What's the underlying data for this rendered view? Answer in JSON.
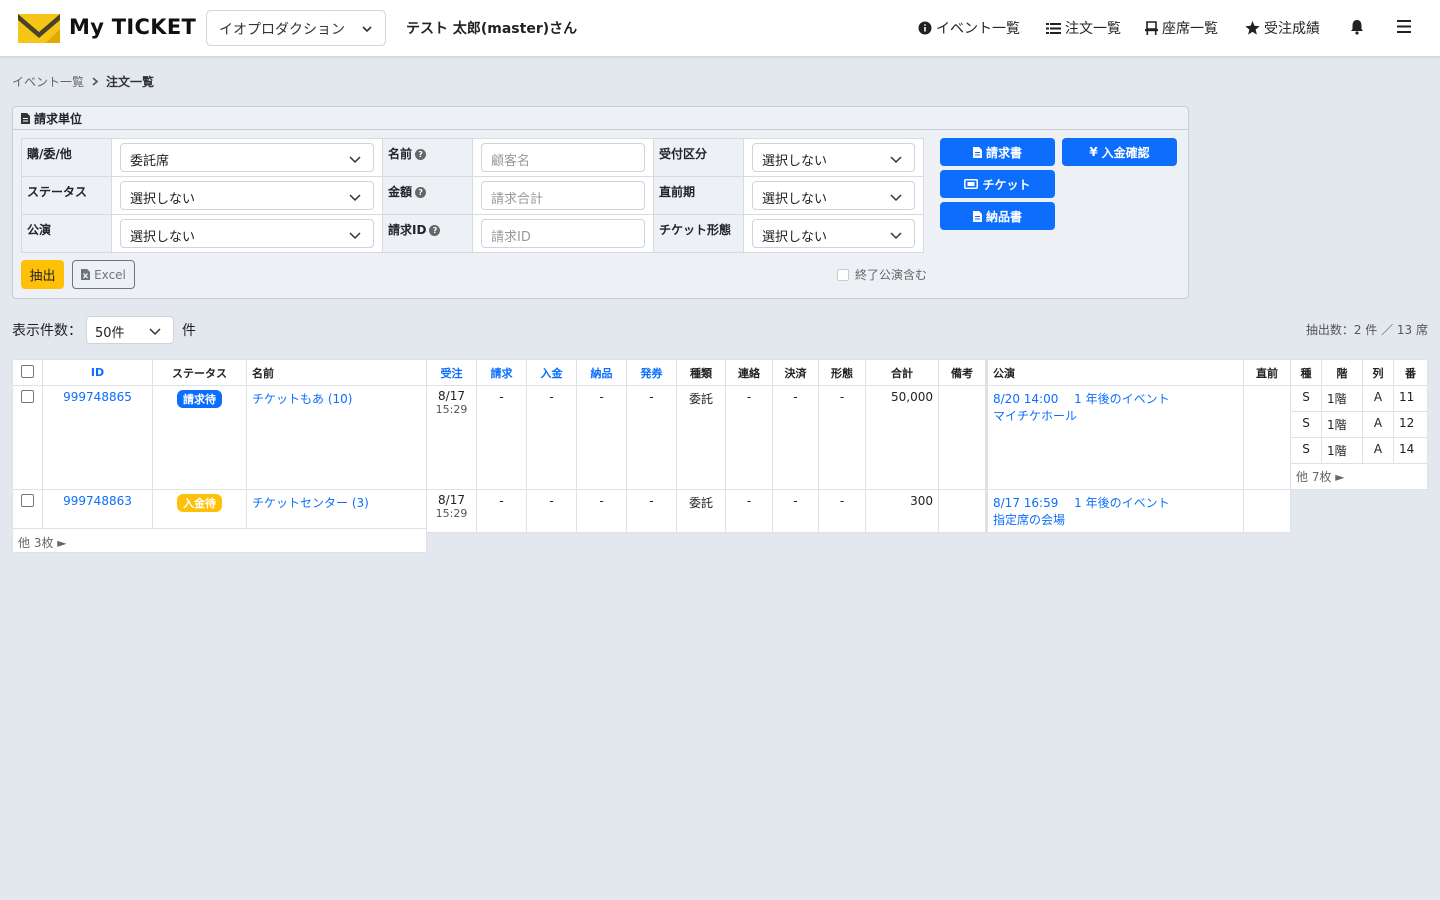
{
  "header": {
    "brand": "My TICKET",
    "org": "イオプロダクション",
    "user": "テスト 太郎(master)さん",
    "nav": [
      {
        "label": "イベント一覧",
        "icon": "info-circle-icon"
      },
      {
        "label": "注文一覧",
        "icon": "list-icon"
      },
      {
        "label": "座席一覧",
        "icon": "seat-icon"
      },
      {
        "label": "受注成績",
        "icon": "star-icon"
      }
    ]
  },
  "breadcrumb": {
    "parent": "イベント一覧",
    "current": "注文一覧"
  },
  "filter": {
    "title": "請求単位",
    "labels": {
      "type": "購/委/他",
      "status": "ステータス",
      "performance": "公演",
      "name": "名前",
      "amount": "金額",
      "invoice_id": "請求ID",
      "reception": "受付区分",
      "last_minute": "直前期",
      "ticket_form": "チケット形態"
    },
    "values": {
      "type": "委託席",
      "status": "選択しない",
      "performance": "選択しない",
      "reception": "選択しない",
      "last_minute": "選択しない",
      "ticket_form": "選択しない"
    },
    "placeholders": {
      "name": "顧客名",
      "amount": "請求合計",
      "invoice_id": "請求ID"
    },
    "buttons": {
      "invoice": "請求書",
      "payment": "入金確認",
      "ticket": "チケット",
      "delivery": "納品書",
      "extract": "抽出",
      "excel": "Excel"
    },
    "include_ended": "終了公演含む"
  },
  "display": {
    "label": "表示件数：",
    "value": "50件",
    "unit": "件"
  },
  "result_count": "抽出数：2 件 ／ 13 席",
  "table": {
    "headers": [
      "ID",
      "ステータス",
      "名前",
      "受注",
      "請求",
      "入金",
      "納品",
      "発券",
      "種類",
      "連絡",
      "決済",
      "形態",
      "合計",
      "備考",
      "公演",
      "直前",
      "種",
      "階",
      "列",
      "番"
    ],
    "rows": [
      {
        "id": "999748865",
        "status": "請求待",
        "name": "チケットもあ (10)",
        "order_date": "8/17",
        "order_time": "15:29",
        "invoice": "-",
        "payment": "-",
        "delivery": "-",
        "issue": "-",
        "kind": "委託",
        "contact": "-",
        "settle": "-",
        "form": "-",
        "total": "50,000",
        "note": "",
        "perf_datetime": "8/20 14:00",
        "perf_title": "1 年後のイベント",
        "venue": "マイチケホール",
        "seats": [
          {
            "type": "S",
            "floor": "1階",
            "row": "A",
            "num": "11"
          },
          {
            "type": "S",
            "floor": "1階",
            "row": "A",
            "num": "12"
          },
          {
            "type": "S",
            "floor": "1階",
            "row": "A",
            "num": "14"
          }
        ],
        "more_seats": "他 7枚 ►"
      },
      {
        "id": "999748863",
        "status": "入金待",
        "name": "チケットセンター (3)",
        "order_date": "8/17",
        "order_time": "15:29",
        "invoice": "-",
        "payment": "-",
        "delivery": "-",
        "issue": "-",
        "kind": "委託",
        "contact": "-",
        "settle": "-",
        "form": "-",
        "total": "300",
        "note": "",
        "perf_datetime": "8/17 16:59",
        "perf_title": "1 年後のイベント",
        "venue": "指定席の会場",
        "more_seats": "他 3枚 ►"
      }
    ]
  },
  "colors": {
    "primary": "#0d6efd",
    "warning": "#ffc107",
    "background": "#e3e7ee"
  }
}
